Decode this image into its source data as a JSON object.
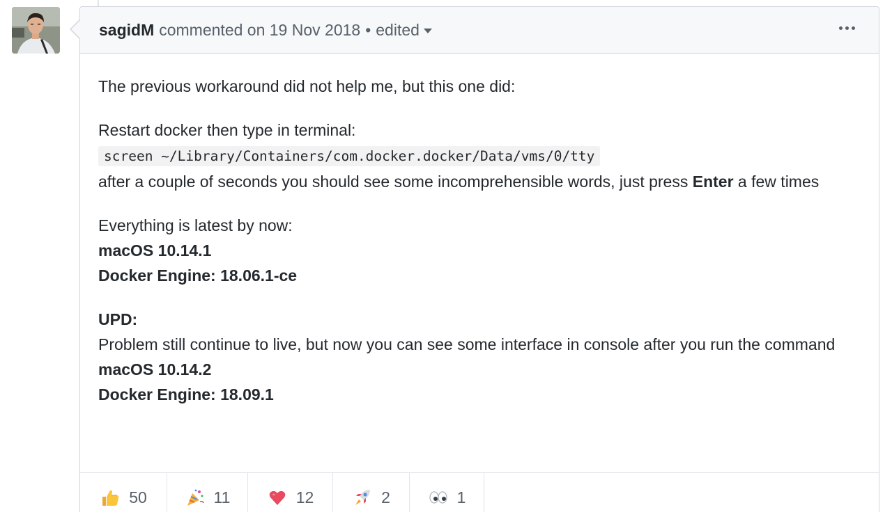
{
  "comment": {
    "author": "sagidM",
    "timestamp": "commented on 19 Nov 2018",
    "separator": "•",
    "edited_label": "edited",
    "paragraphs": {
      "p1": "The previous workaround did not help me, but this one did:",
      "p2_intro": "Restart docker then type in terminal:",
      "p2_code": "screen ~/Library/Containers/com.docker.docker/Data/vms/0/tty",
      "p2_after_a": "after a couple of seconds you should see some incomprehensible words, just press ",
      "p2_after_bold": "Enter",
      "p2_after_b": " a few times",
      "p3_intro": "Everything is latest by now:",
      "p3_os": "macOS 10.14.1",
      "p3_engine": "Docker Engine: 18.06.1-ce",
      "p4_heading": "UPD:",
      "p4_text": "Problem still continue to live, but now you can see some interface in console after you run the command",
      "p4_os": "macOS 10.14.2",
      "p4_engine": "Docker Engine: 18.09.1"
    }
  },
  "reactions": [
    {
      "icon": "thumbs-up-icon",
      "count": "50"
    },
    {
      "icon": "party-popper-icon",
      "count": "11"
    },
    {
      "icon": "heart-icon",
      "count": "12"
    },
    {
      "icon": "rocket-icon",
      "count": "2"
    },
    {
      "icon": "eyes-icon",
      "count": "1"
    }
  ],
  "colors": {
    "header_bg": "#f6f8fa",
    "border": "#d1d5da",
    "text": "#24292e",
    "muted": "#586069",
    "heart": "#e84a5f"
  }
}
